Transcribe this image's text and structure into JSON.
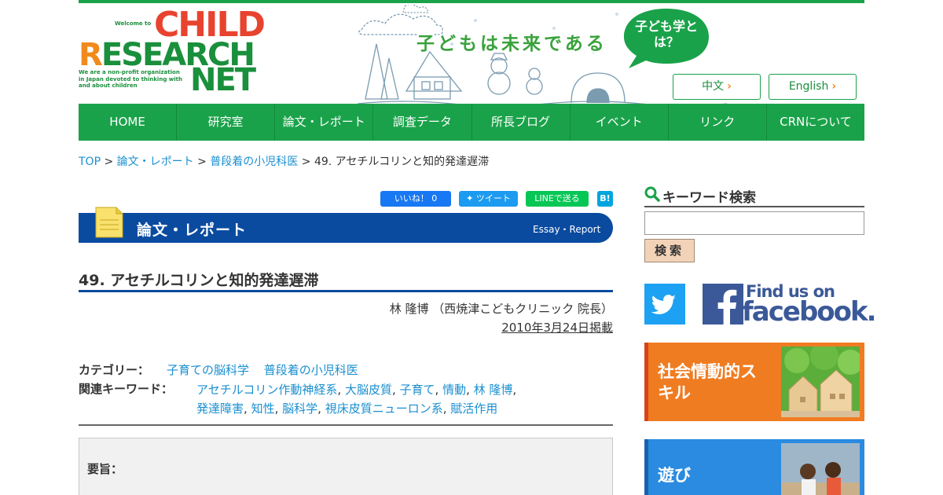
{
  "header": {
    "logo_welcome": "Welcome to",
    "logo_word1": "CHILD",
    "logo_word2": "RESEARCH",
    "logo_word3": "NET",
    "logo_tagline": "We are a non-profit organization in Japan devoted to thinking with and about children",
    "slogan": "子どもは未来である",
    "bubble_text": "子ども学とは？",
    "lang_zh": "中文",
    "lang_en": "English"
  },
  "nav": {
    "items": [
      "HOME",
      "研究室",
      "論文・レポート",
      "調査データ",
      "所長ブログ",
      "イベント",
      "リンク",
      "CRNについて"
    ]
  },
  "breadcrumb": {
    "items": [
      "TOP",
      "論文・レポート",
      "普段着の小児科医"
    ],
    "separator": ">",
    "current": "49. アセチルコリンと知的発達遅滞"
  },
  "social": {
    "fb_like": "いいね！ 0",
    "tweet": "ツイート",
    "line": "LINEで送る",
    "hatena": "B!"
  },
  "section": {
    "title": "論文・レポート",
    "subtitle": "Essay・Report"
  },
  "article": {
    "title": "49. アセチルコリンと知的発達遅滞",
    "author": "林 隆博 （西焼津こどもクリニック 院長）",
    "date": "2010年3月24日掲載",
    "category_label": "カテゴリー：",
    "categories": [
      "子育ての脳科学",
      "普段着の小児科医"
    ],
    "keyword_label": "関連キーワード：",
    "keywords": [
      "アセチルコリン作動神経系",
      "大脳皮質",
      "子育て",
      "情動",
      "林 隆博",
      "発達障害",
      "知性",
      "脳科学",
      "視床皮質ニューロン系",
      "賦活作用"
    ],
    "summary_label": "要旨："
  },
  "sidebar": {
    "search_title": "キーワード検索",
    "search_placeholder": "",
    "search_button": "検索",
    "fb_find": "Find us on",
    "fb_word": "facebook.",
    "card1": "社会情動的スキル",
    "card2": "遊び"
  },
  "colors": {
    "green": "#1aa24a",
    "blue": "#0a4ba0",
    "link": "#1b8fd0",
    "orange": "#f07c22"
  }
}
